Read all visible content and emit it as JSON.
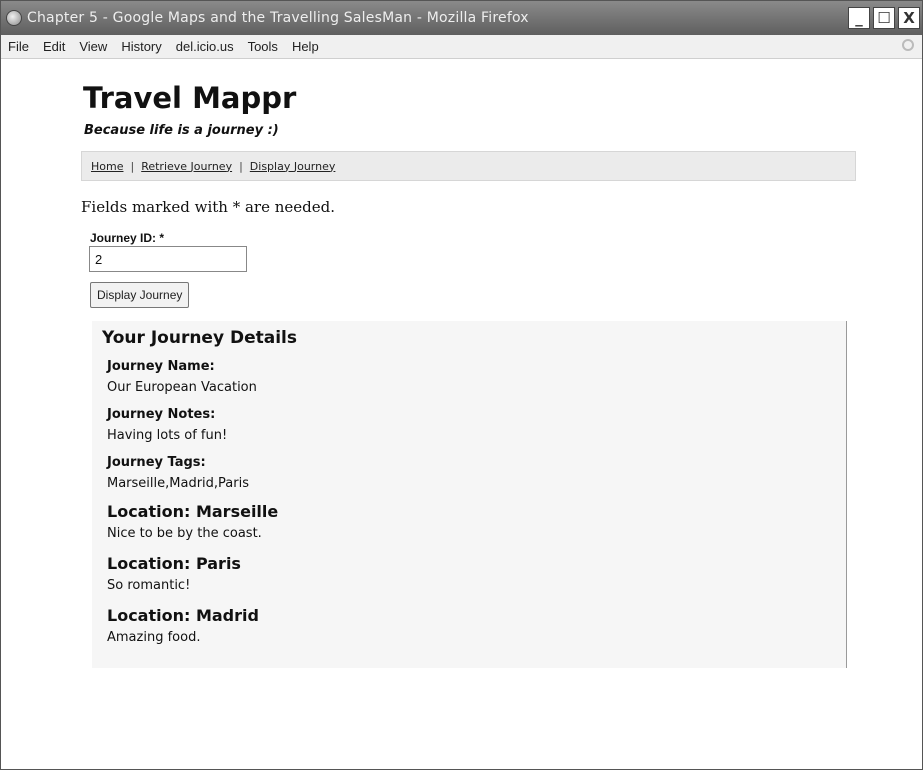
{
  "window": {
    "title": "Chapter 5 - Google Maps and the Travelling SalesMan - Mozilla Firefox",
    "controls": {
      "minimize": "_",
      "maximize": "☐",
      "close": "X"
    }
  },
  "menubar": {
    "items": [
      {
        "label": "File"
      },
      {
        "label": "Edit"
      },
      {
        "label": "View"
      },
      {
        "label": "History"
      },
      {
        "label": "del.icio.us"
      },
      {
        "label": "Tools"
      },
      {
        "label": "Help"
      }
    ]
  },
  "site": {
    "title": "Travel Mappr",
    "tagline": "Because life is a journey :)"
  },
  "nav": {
    "links": [
      {
        "label": "Home"
      },
      {
        "label": "Retrieve Journey"
      },
      {
        "label": "Display Journey"
      }
    ],
    "separator": "|"
  },
  "form": {
    "required_note": "Fields marked with * are needed.",
    "journey_id_label": "Journey ID: *",
    "journey_id_value": "2",
    "submit_label": "Display Journey"
  },
  "details": {
    "heading": "Your Journey Details",
    "name_label": "Journey Name:",
    "name_value": "Our European Vacation",
    "notes_label": "Journey Notes:",
    "notes_value": "Having lots of fun!",
    "tags_label": "Journey Tags:",
    "tags_value": "Marseille,Madrid,Paris",
    "locations": [
      {
        "title": "Location: Marseille",
        "note": "Nice to be by the coast."
      },
      {
        "title": "Location: Paris",
        "note": "So romantic!"
      },
      {
        "title": "Location: Madrid",
        "note": "Amazing food."
      }
    ]
  }
}
